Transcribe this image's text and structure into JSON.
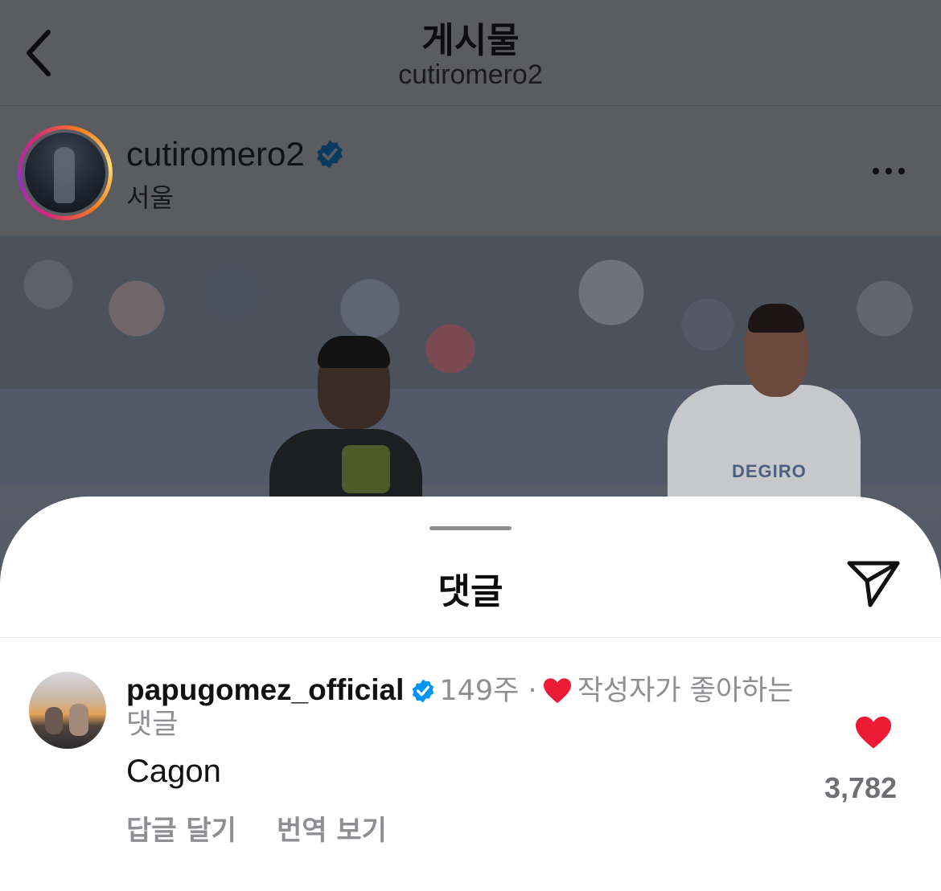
{
  "header": {
    "title": "게시물",
    "subtitle": "cutiromero2"
  },
  "post": {
    "username": "cutiromero2",
    "verified": true,
    "location": "서울",
    "image_sponsor_text": "DEGIRO"
  },
  "comments_sheet": {
    "title": "댓글",
    "comment": {
      "username": "papugomez_official",
      "verified": true,
      "age": "149주",
      "separator": "·",
      "author_liked_label_line1": "작성자가 좋아하는",
      "author_liked_label_line2": "댓글",
      "text": "Cagon",
      "reply_label": "답글 달기",
      "translate_label": "번역 보기",
      "like_count": "3,782",
      "liked": true
    }
  },
  "colors": {
    "dim_overlay": "#5a5b5f",
    "like_red": "#ed1a36",
    "verified_blue": "#0095f6",
    "secondary_text": "#8e8e93"
  },
  "icons": {
    "back": "chevron-left-icon",
    "verified": "verified-badge-icon",
    "more": "ellipsis-icon",
    "share": "paper-plane-icon",
    "like": "heart-icon"
  }
}
